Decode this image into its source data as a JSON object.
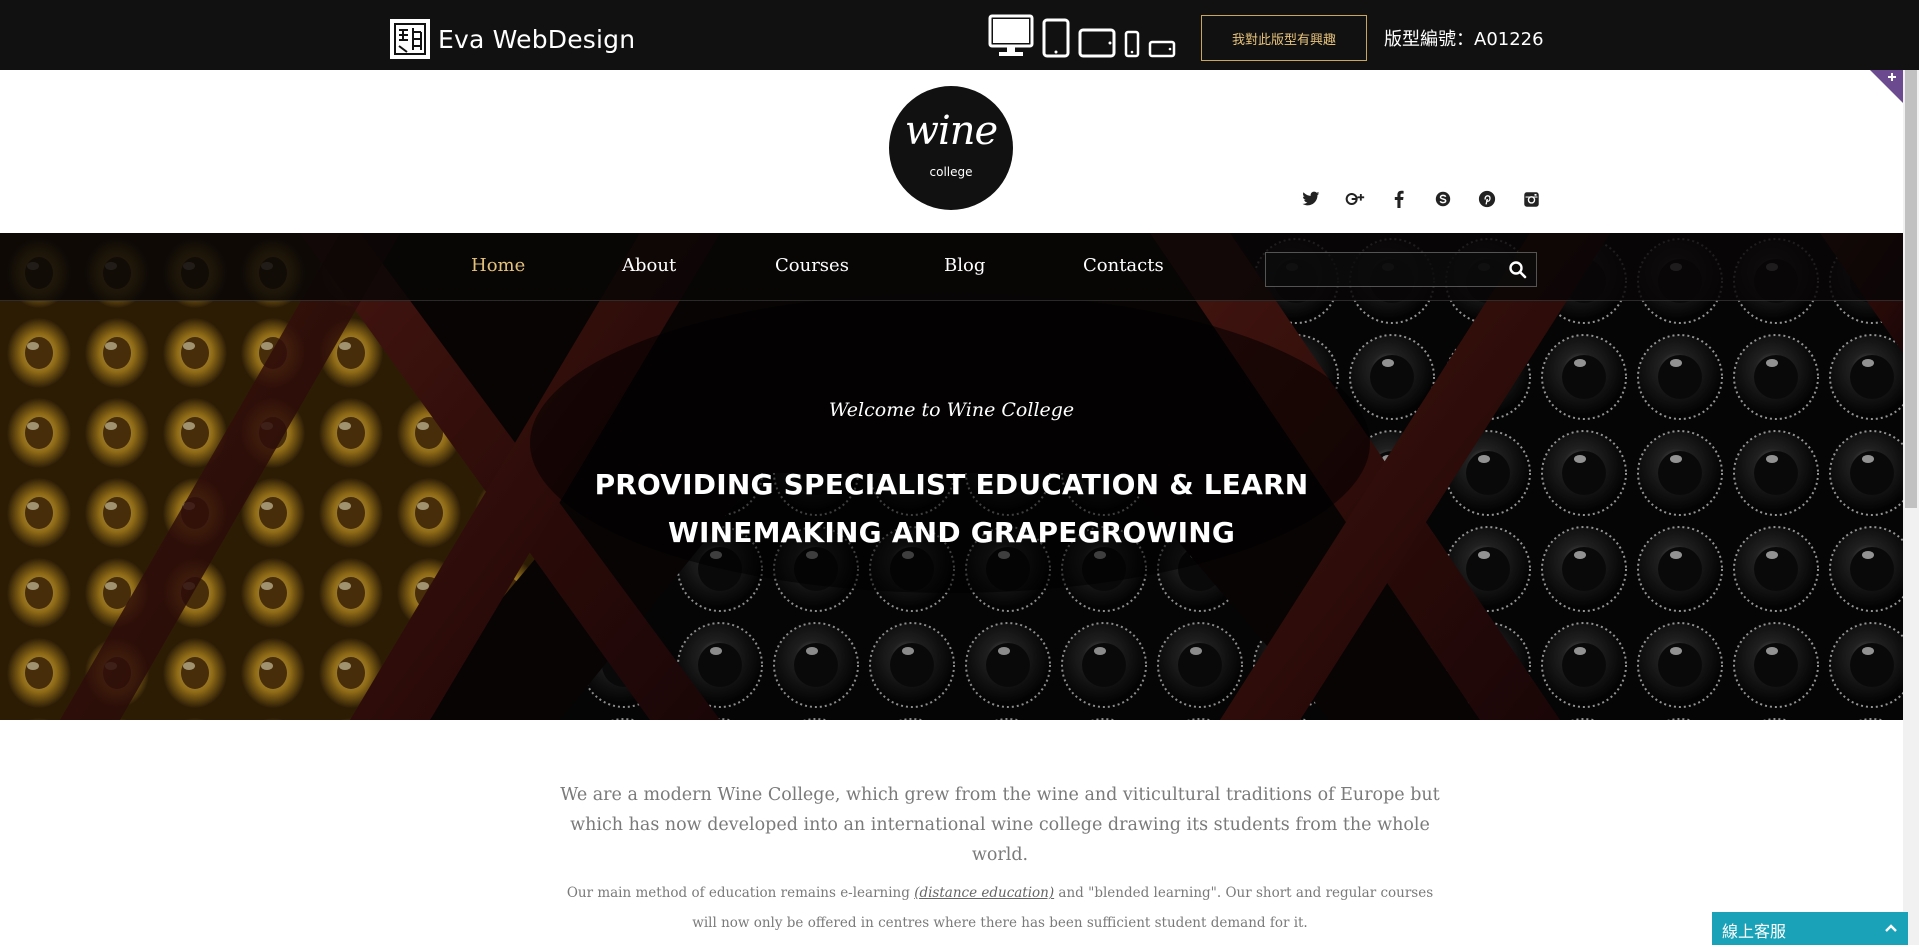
{
  "preview_bar": {
    "brand_name": "Eva WebDesign",
    "devices": [
      "desktop-icon",
      "tablet-portrait-icon",
      "tablet-landscape-icon",
      "phone-portrait-icon",
      "phone-landscape-icon"
    ],
    "interest_button": "我對此版型有興趣",
    "template_code": "版型編號：A01226",
    "accent_color": "#c9a65a"
  },
  "header": {
    "logo_word": "wine",
    "logo_sub": "college",
    "socials": [
      "twitter-icon",
      "google-plus-icon",
      "facebook-icon",
      "skype-icon",
      "pinterest-icon",
      "instagram-icon"
    ]
  },
  "nav": {
    "items": [
      {
        "label": "Home",
        "active": true
      },
      {
        "label": "About",
        "active": false
      },
      {
        "label": "Courses",
        "active": false
      },
      {
        "label": "Blog",
        "active": false
      },
      {
        "label": "Contacts",
        "active": false
      }
    ],
    "active_color": "#e4c27c",
    "search": {
      "value": "",
      "placeholder": ""
    }
  },
  "hero": {
    "tagline": "Welcome to Wine College",
    "title_line1": "PROVIDING SPECIALIST EDUCATION & LEARN",
    "title_line2": "WINEMAKING AND GRAPEGROWING"
  },
  "content": {
    "intro": "We are a modern Wine College, which grew from the wine and viticultural traditions of Europe but which has now developed into an international wine college drawing its students from the whole world.",
    "detail_before": "Our main method of education remains e-learning ",
    "detail_link": "(distance education)",
    "detail_after": " and \"blended learning\". Our short and regular courses will now only be offered in centres where there has been sufficient student demand for it."
  },
  "chat": {
    "label": "線上客服",
    "color": "#1aa3b8"
  }
}
